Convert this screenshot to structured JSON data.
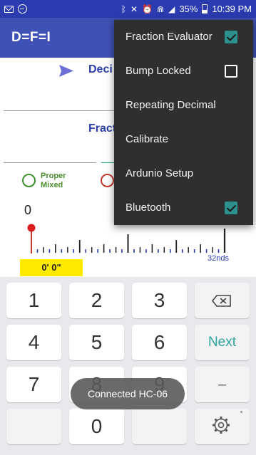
{
  "status_bar": {
    "battery": "35%",
    "time": "10:39 PM",
    "left_icons": [
      "mail-icon",
      "do-not-disturb-icon"
    ],
    "right_icons": [
      "bluetooth-icon",
      "mute-icon",
      "alarm-icon",
      "wifi-icon",
      "signal-icon",
      "battery-icon"
    ]
  },
  "app": {
    "title": "D=F=I",
    "accent_color": "#3f51b5"
  },
  "main": {
    "decimal_label_partial": "Deci",
    "fraction_label_partial": "Fract",
    "radio_option": {
      "line1": "Proper",
      "line2": "Mixed"
    },
    "ruler": {
      "start_value": "0",
      "unit_label": "32nds",
      "measurement": "0' 0\""
    }
  },
  "menu": {
    "items": [
      {
        "label": "Fraction Evaluator",
        "checkable": true,
        "checked": true
      },
      {
        "label": "Bump Locked",
        "checkable": true,
        "checked": false
      },
      {
        "label": "Repeating Decimal",
        "checkable": false
      },
      {
        "label": "Calibrate",
        "checkable": false
      },
      {
        "label": "Ardunio Setup",
        "checkable": false
      },
      {
        "label": "Bluetooth",
        "checkable": true,
        "checked": true
      }
    ]
  },
  "keyboard": {
    "keys": [
      "1",
      "2",
      "3",
      "4",
      "5",
      "6",
      "7",
      "8",
      "9",
      "0"
    ],
    "next_label": "Next",
    "minus_label": "–"
  },
  "toast": {
    "text": "Connected HC-06"
  }
}
